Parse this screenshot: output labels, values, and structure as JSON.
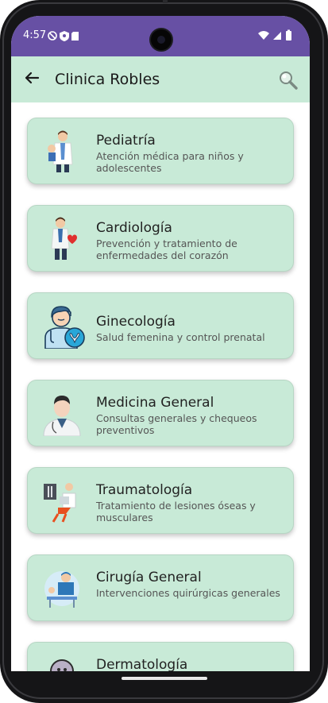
{
  "status_bar": {
    "time": "4:57"
  },
  "app_bar": {
    "title": "Clinica Robles"
  },
  "specialties": [
    {
      "title": "Pediatría",
      "description": "Atención médica para niños y adolescentes"
    },
    {
      "title": "Cardiología",
      "description": "Prevención y tratamiento de enfermedades del corazón"
    },
    {
      "title": "Ginecología",
      "description": "Salud femenina y control prenatal"
    },
    {
      "title": "Medicina General",
      "description": "Consultas generales y chequeos preventivos"
    },
    {
      "title": "Traumatología",
      "description": "Tratamiento de lesiones óseas y musculares"
    },
    {
      "title": "Cirugía General",
      "description": "Intervenciones quirúrgicas generales"
    },
    {
      "title": "Dermatología",
      "description": ""
    }
  ],
  "colors": {
    "status_bar": "#6750a4",
    "app_bar": "#c8ead7",
    "card_background": "#c8ead7"
  },
  "icons": {
    "back": "arrow-back-icon",
    "search": "search-icon"
  }
}
